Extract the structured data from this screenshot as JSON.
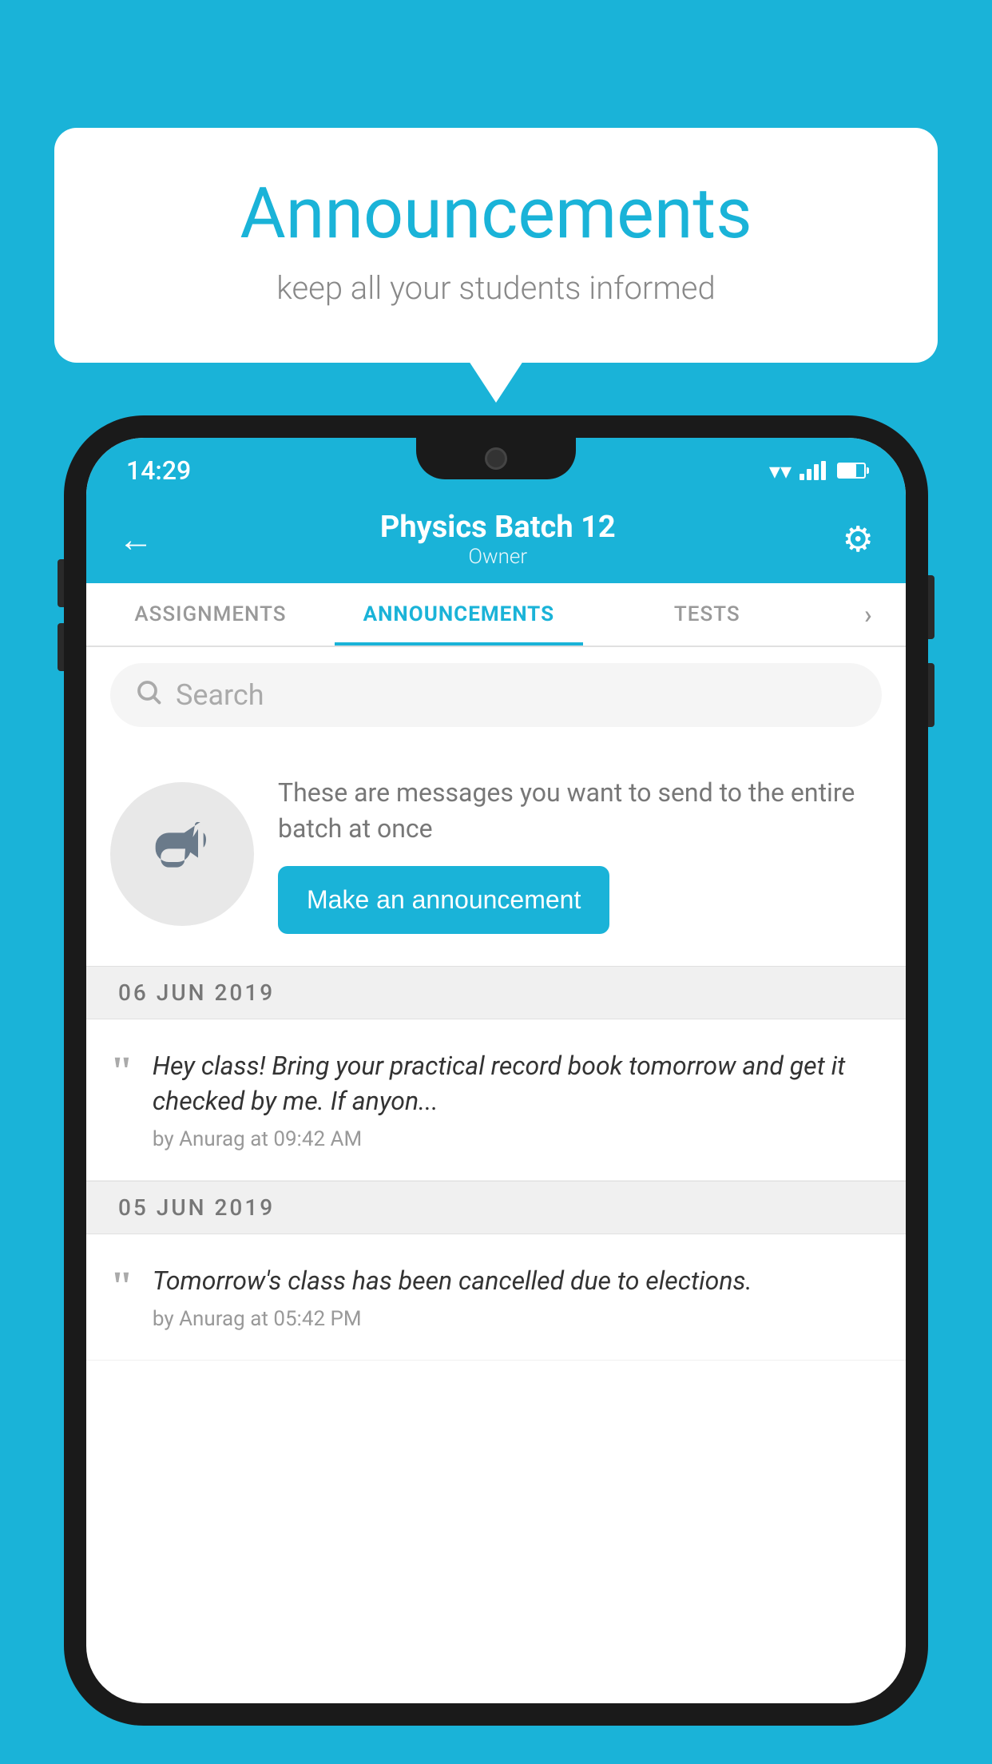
{
  "background_color": "#1ab3d8",
  "speech_bubble": {
    "title": "Announcements",
    "subtitle": "keep all your students informed"
  },
  "phone": {
    "status_bar": {
      "time": "14:29"
    },
    "header": {
      "title": "Physics Batch 12",
      "subtitle": "Owner",
      "back_label": "←",
      "settings_label": "⚙"
    },
    "tabs": [
      {
        "label": "ASSIGNMENTS",
        "active": false
      },
      {
        "label": "ANNOUNCEMENTS",
        "active": true
      },
      {
        "label": "TESTS",
        "active": false
      },
      {
        "label": "",
        "active": false
      }
    ],
    "search": {
      "placeholder": "Search"
    },
    "promo": {
      "description": "These are messages you want to send to the entire batch at once",
      "button_label": "Make an announcement"
    },
    "announcements": [
      {
        "date": "06  JUN  2019",
        "text": "Hey class! Bring your practical record book tomorrow and get it checked by me. If anyon...",
        "author": "by Anurag at 09:42 AM"
      },
      {
        "date": "05  JUN  2019",
        "text": "Tomorrow's class has been cancelled due to elections.",
        "author": "by Anurag at 05:42 PM"
      }
    ]
  }
}
